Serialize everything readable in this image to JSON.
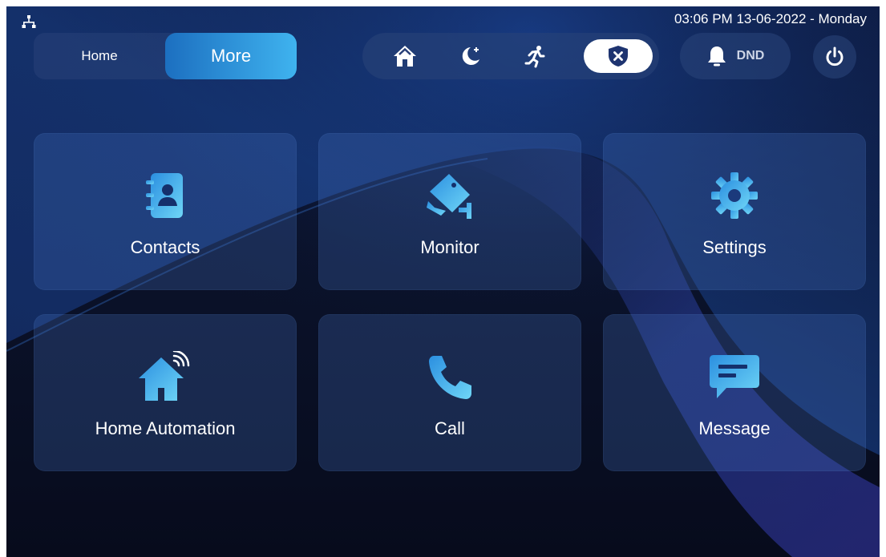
{
  "status_bar": {
    "network_icon": "network-icon",
    "datetime": "03:06 PM  13-06-2022 - Monday"
  },
  "nav_toggle": {
    "home_label": "Home",
    "more_label": "More",
    "selected": "More"
  },
  "scene_modes": {
    "items": [
      {
        "name": "home-mode",
        "icon": "house-icon"
      },
      {
        "name": "sleep-mode",
        "icon": "moon-icon"
      },
      {
        "name": "away-mode",
        "icon": "running-person-icon"
      },
      {
        "name": "disarm-mode",
        "icon": "shield-x-icon"
      }
    ],
    "active": "disarm-mode"
  },
  "dnd": {
    "label": "DND",
    "icon": "bell-icon"
  },
  "power": {
    "icon": "power-icon"
  },
  "tiles": [
    {
      "label": "Contacts",
      "icon": "contacts-book-icon"
    },
    {
      "label": "Monitor",
      "icon": "cctv-camera-icon"
    },
    {
      "label": "Settings",
      "icon": "gear-icon"
    },
    {
      "label": "Home Automation",
      "icon": "smart-home-icon"
    },
    {
      "label": "Call",
      "icon": "phone-icon"
    },
    {
      "label": "Message",
      "icon": "message-icon"
    }
  ],
  "colors": {
    "background": "#0a1128",
    "accent_start": "#1c6fc0",
    "accent_end": "#3fb3ef",
    "icon_gradient_start": "#2b8fe0",
    "icon_gradient_end": "#6fd6f7"
  }
}
